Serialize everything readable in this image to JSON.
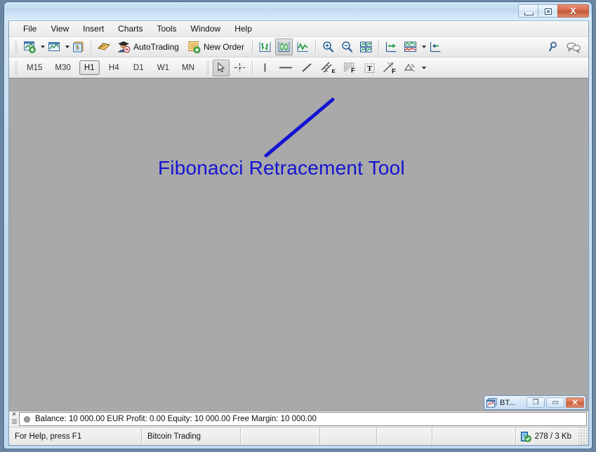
{
  "window": {
    "title": "",
    "controls": {
      "minimize": "Minimize",
      "maximize": "Maximize",
      "close": "Close",
      "close_glyph": "X"
    }
  },
  "menu": {
    "items": [
      {
        "label": "File"
      },
      {
        "label": "View"
      },
      {
        "label": "Insert"
      },
      {
        "label": "Charts"
      },
      {
        "label": "Tools"
      },
      {
        "label": "Window"
      },
      {
        "label": "Help"
      }
    ]
  },
  "main_toolbar": {
    "buttons": [
      {
        "name": "new-chart",
        "icon": "new-chart-icon",
        "label": "",
        "dropdown": true
      },
      {
        "name": "profiles",
        "icon": "profiles-icon",
        "label": "",
        "dropdown": true
      },
      {
        "name": "market-watch",
        "icon": "market-watch-icon",
        "label": "",
        "dropdown": false
      },
      {
        "name": "navigator",
        "icon": "navigator-icon",
        "label": "",
        "dropdown": false
      },
      {
        "name": "autotrading",
        "icon": "autotrading-icon",
        "label": "AutoTrading",
        "dropdown": false
      },
      {
        "name": "new-order",
        "icon": "new-order-icon",
        "label": "New Order",
        "dropdown": false
      },
      {
        "name": "bar-chart",
        "icon": "bar-chart-icon",
        "label": "",
        "dropdown": false
      },
      {
        "name": "candlestick-chart",
        "icon": "candlestick-chart-icon",
        "label": "",
        "dropdown": false,
        "pressed": true
      },
      {
        "name": "line-chart",
        "icon": "line-chart-icon",
        "label": "",
        "dropdown": false
      },
      {
        "name": "zoom-in",
        "icon": "zoom-in-icon",
        "label": "",
        "dropdown": false
      },
      {
        "name": "zoom-out",
        "icon": "zoom-out-icon",
        "label": "",
        "dropdown": false
      },
      {
        "name": "tile-windows",
        "icon": "tile-windows-icon",
        "label": "",
        "dropdown": false
      },
      {
        "name": "chart-shift",
        "icon": "chart-shift-icon",
        "label": "",
        "dropdown": false
      },
      {
        "name": "indicators",
        "icon": "indicators-icon",
        "label": "",
        "dropdown": true
      },
      {
        "name": "auto-scroll",
        "icon": "auto-scroll-icon",
        "label": "",
        "dropdown": false
      }
    ],
    "right_buttons": [
      {
        "name": "search",
        "icon": "search-icon"
      },
      {
        "name": "chat",
        "icon": "chat-icon"
      }
    ]
  },
  "timeframes": {
    "items": [
      {
        "label": "M15",
        "active": false
      },
      {
        "label": "M30",
        "active": false
      },
      {
        "label": "H1",
        "active": true
      },
      {
        "label": "H4",
        "active": false
      },
      {
        "label": "D1",
        "active": false
      },
      {
        "label": "W1",
        "active": false
      },
      {
        "label": "MN",
        "active": false
      }
    ]
  },
  "drawing_toolbar": {
    "tools": [
      {
        "name": "cursor",
        "icon": "cursor-arrow-icon",
        "pressed": true
      },
      {
        "name": "crosshair",
        "icon": "crosshair-icon",
        "pressed": false
      },
      {
        "name": "vertical-line",
        "icon": "vertical-line-icon",
        "pressed": false
      },
      {
        "name": "horizontal-line",
        "icon": "horizontal-line-icon",
        "pressed": false
      },
      {
        "name": "trendline",
        "icon": "trendline-icon",
        "pressed": false
      },
      {
        "name": "equidistant-channel",
        "icon": "equidistant-channel-icon",
        "pressed": false
      },
      {
        "name": "fibonacci-retracement",
        "icon": "fibonacci-retracement-icon",
        "pressed": false,
        "highlighted": true
      },
      {
        "name": "text",
        "icon": "text-icon",
        "pressed": false
      },
      {
        "name": "fibonacci-fan",
        "icon": "fibonacci-fan-icon",
        "pressed": false
      },
      {
        "name": "shapes",
        "icon": "shapes-icon",
        "pressed": false,
        "dropdown": true
      }
    ]
  },
  "annotation": {
    "text": "Fibonacci Retracement Tool",
    "color": "#1414d2"
  },
  "mdi_child": {
    "title": "BT...",
    "icon": "chart-window-icon",
    "restore_glyph": "❐",
    "maximize_glyph": "▭",
    "close_glyph": "✕"
  },
  "terminal": {
    "balance_line": "Balance: 10 000.00 EUR  Profit: 0.00  Equity: 10 000.00  Free Margin: 10 000.00"
  },
  "statusbar": {
    "help": "For Help, press F1",
    "account": "Bitcoin Trading",
    "cell3": "",
    "cell4": "",
    "cell5": "",
    "cell6": "",
    "traffic": "278 / 3 Kb"
  },
  "colors": {
    "chart_background": "#a9a9a9",
    "highlight": "#1414d2",
    "titlebar": "#c9e0f5"
  }
}
